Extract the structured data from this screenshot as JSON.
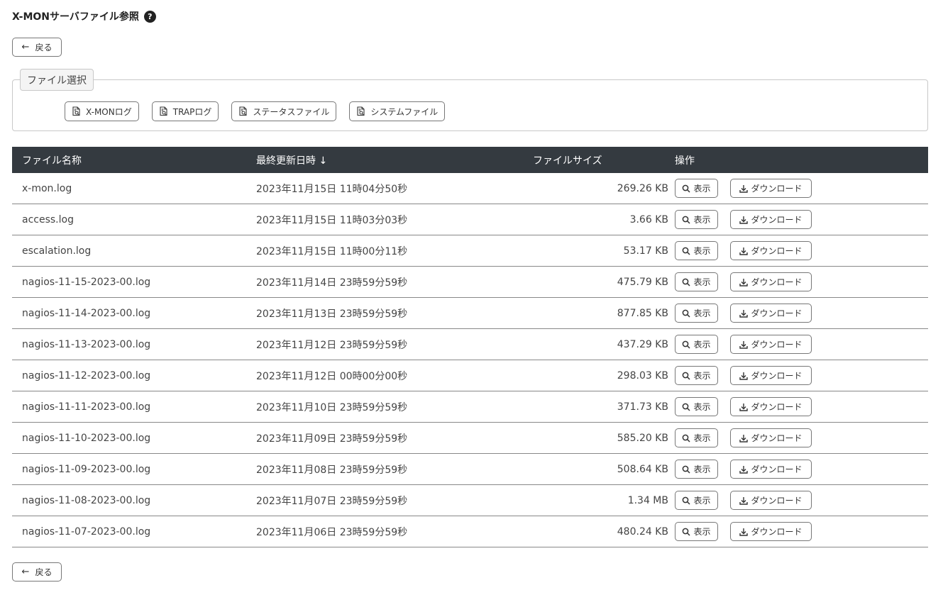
{
  "header": {
    "title": "X-MONサーバファイル参照",
    "help_icon": "?"
  },
  "back_button": {
    "arrow": "←",
    "label": "戻る"
  },
  "file_selection": {
    "legend": "ファイル選択",
    "buttons": [
      {
        "label": "X-MONログ",
        "icon": "document-search-icon"
      },
      {
        "label": "TRAPログ",
        "icon": "document-search-icon"
      },
      {
        "label": "ステータスファイル",
        "icon": "document-search-icon"
      },
      {
        "label": "システムファイル",
        "icon": "document-search-icon"
      }
    ]
  },
  "table": {
    "headers": {
      "name": "ファイル名称",
      "updated": "最終更新日時 ↓",
      "size": "ファイルサイズ",
      "ops": "操作"
    },
    "view_label": "表示",
    "download_label": "ダウンロード",
    "rows": [
      {
        "name": "x-mon.log",
        "updated": "2023年11月15日 11時04分50秒",
        "size": "269.26 KB"
      },
      {
        "name": "access.log",
        "updated": "2023年11月15日 11時03分03秒",
        "size": "3.66 KB"
      },
      {
        "name": "escalation.log",
        "updated": "2023年11月15日 11時00分11秒",
        "size": "53.17 KB"
      },
      {
        "name": "nagios-11-15-2023-00.log",
        "updated": "2023年11月14日 23時59分59秒",
        "size": "475.79 KB"
      },
      {
        "name": "nagios-11-14-2023-00.log",
        "updated": "2023年11月13日 23時59分59秒",
        "size": "877.85 KB"
      },
      {
        "name": "nagios-11-13-2023-00.log",
        "updated": "2023年11月12日 23時59分59秒",
        "size": "437.29 KB"
      },
      {
        "name": "nagios-11-12-2023-00.log",
        "updated": "2023年11月12日 00時00分00秒",
        "size": "298.03 KB"
      },
      {
        "name": "nagios-11-11-2023-00.log",
        "updated": "2023年11月10日 23時59分59秒",
        "size": "371.73 KB"
      },
      {
        "name": "nagios-11-10-2023-00.log",
        "updated": "2023年11月09日 23時59分59秒",
        "size": "585.20 KB"
      },
      {
        "name": "nagios-11-09-2023-00.log",
        "updated": "2023年11月08日 23時59分59秒",
        "size": "508.64 KB"
      },
      {
        "name": "nagios-11-08-2023-00.log",
        "updated": "2023年11月07日 23時59分59秒",
        "size": "1.34 MB"
      },
      {
        "name": "nagios-11-07-2023-00.log",
        "updated": "2023年11月06日 23時59分59秒",
        "size": "480.24 KB"
      }
    ]
  }
}
